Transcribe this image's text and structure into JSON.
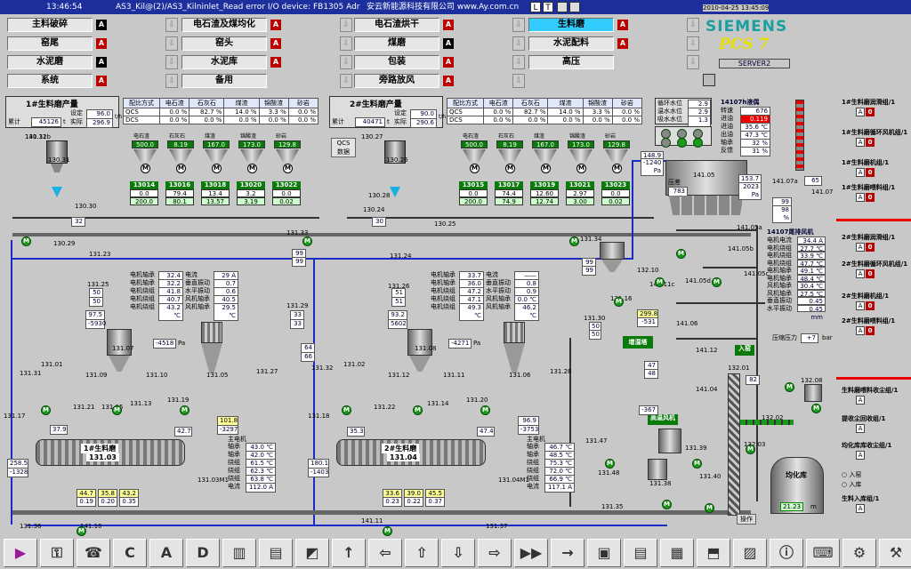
{
  "header": {
    "time": "13:46:54",
    "message": "AS3_Kil@(2)/AS3_Kilninlet_Read error I/O device: FB1305 Adr",
    "company": "安云新能源科技有限公司 www.Ay.com.cn",
    "datetime": "2010-04-25 13:45:09",
    "brand": "SIEMENS",
    "product": "PCS 7",
    "server": "SERVER2",
    "nav_icons": [
      "L",
      "T"
    ]
  },
  "nav": [
    {
      "label": "主料破碎",
      "alarm": "A",
      "black": true
    },
    {
      "label": "电石渣及煤均化",
      "alarm": "A",
      "black": false
    },
    {
      "label": "电石渣烘干",
      "alarm": "A",
      "black": false
    },
    {
      "label": "生料磨",
      "alarm": "A",
      "black": false,
      "active": true
    },
    {
      "label": "窑尾",
      "alarm": "A",
      "black": false
    },
    {
      "label": "窑头",
      "alarm": "A",
      "black": false
    },
    {
      "label": "煤磨",
      "alarm": "A",
      "black": true
    },
    {
      "label": "水泥配料",
      "alarm": "A",
      "black": false
    },
    {
      "label": "水泥磨",
      "alarm": "A",
      "black": true
    },
    {
      "label": "水泥库",
      "alarm": "A",
      "black": false
    },
    {
      "label": "包装",
      "alarm": "A",
      "black": false
    },
    {
      "label": "高压",
      "alarm": "",
      "black": false
    },
    {
      "label": "系统",
      "alarm": "A",
      "black": false
    },
    {
      "label": "备用",
      "alarm": "",
      "black": false
    },
    {
      "label": "旁路放风",
      "alarm": "A",
      "black": false
    }
  ],
  "mill1": {
    "title": "1#生料磨产量",
    "set_label": "设定",
    "set_val": "96.0",
    "act_label": "实际",
    "act_val": "296.9",
    "unit": "t/h",
    "total_label": "累计",
    "total_val": "45126",
    "total_unit": "t",
    "table": {
      "headers": [
        "配比方式",
        "电石渣",
        "石灰石",
        "煤渣",
        "锦酸渣",
        "砂岩"
      ],
      "rows": [
        [
          "QCS",
          "0.0 %",
          "82.7 %",
          "14.0 %",
          "3.3 %",
          "0.0 %"
        ],
        [
          "DCS",
          "0.0 %",
          "0.0 %",
          "0.0 %",
          "0.0 %",
          "0.0 %"
        ]
      ]
    },
    "bins": [
      [
        "电石渣",
        "500.0"
      ],
      [
        "石灰石",
        "8.19"
      ],
      [
        "煤渣",
        "167.0"
      ],
      [
        "锦酸渣",
        "173.0"
      ],
      [
        "砂岩",
        "129.8"
      ]
    ],
    "feeders": [
      {
        "id": "13014",
        "a": "0.0",
        "b": "200.0"
      },
      {
        "id": "13016",
        "a": "79.4",
        "b": "80.1"
      },
      {
        "id": "13018",
        "a": "13.4",
        "b": "13.57"
      },
      {
        "id": "13020",
        "a": "3.2",
        "b": "3.19"
      },
      {
        "id": "13022",
        "a": "0.0",
        "b": "0.02"
      }
    ],
    "motor_temps": [
      [
        "电机轴承",
        "32.4 ℃"
      ],
      [
        "电机轴承",
        "32.2 ℃"
      ],
      [
        "电机绕组",
        "41.8 ℃"
      ],
      [
        "电机绕组",
        "40.7 ℃"
      ],
      [
        "电机绕组",
        "43.2 ℃"
      ]
    ],
    "motor_right": [
      [
        "电流",
        "29 A"
      ],
      [
        "垂直振动",
        "0.7 mm"
      ],
      [
        "水平振动",
        "0.6 mm"
      ],
      [
        "风机轴承",
        "40.5 ℃"
      ],
      [
        "风机轴承",
        "29.5 ℃"
      ]
    ],
    "pressure1": "97.5",
    "pressure2": "-5930",
    "pa": "Pa",
    "p_cyclone": "-4518",
    "p_cyclone_u": "Pa",
    "pct_a": "50",
    "pct_b": "50",
    "pct_c": "33",
    "pct_d": "33",
    "out_temp": "101.8",
    "out_press": "-3297",
    "in_temp": "37.9",
    "mid_temp": "42.7",
    "mill_name": "1#生料磨",
    "mill_id": "131.03",
    "motor_id": "131.03M1",
    "main_motor_title": "主电机",
    "main_motor": [
      [
        "轴承",
        "43.0 ℃"
      ],
      [
        "轴承",
        "42.0 ℃"
      ],
      [
        "绕组",
        "61.5 ℃"
      ],
      [
        "绕组",
        "62.3 ℃"
      ],
      [
        "绕组",
        "63.8 ℃"
      ],
      [
        "电流",
        "112.0 A"
      ]
    ],
    "yellow": [
      "44.7",
      "35.8",
      "43.2"
    ],
    "blue": [
      "0.19",
      "0.20",
      "0.35"
    ],
    "left_temp": "258.5",
    "left_press": "-1328",
    "pa2": "Pa"
  },
  "mill2": {
    "title": "2#生料磨产量",
    "set_label": "设定",
    "set_val": "90.0",
    "act_label": "实际",
    "act_val": "290.6",
    "unit": "t/h",
    "total_label": "累计",
    "total_val": "40471",
    "total_unit": "t",
    "table": {
      "headers": [
        "配比方式",
        "电石渣",
        "石灰石",
        "煤渣",
        "锦酸渣",
        "砂岩"
      ],
      "rows": [
        [
          "QCS",
          "0.0 %",
          "82.7 %",
          "14.0 %",
          "3.3 %",
          "0.0 %"
        ],
        [
          "DCS",
          "0.0 %",
          "0.0 %",
          "0.0 %",
          "0.0 %",
          "0.0 %"
        ]
      ]
    },
    "bins": [
      [
        "电石渣",
        "500.0"
      ],
      [
        "石灰石",
        "8.19"
      ],
      [
        "煤渣",
        "167.0"
      ],
      [
        "锦酸渣",
        "173.0"
      ],
      [
        "砂岩",
        "129.8"
      ]
    ],
    "feeders": [
      {
        "id": "13015",
        "a": "0.0",
        "b": "200.0"
      },
      {
        "id": "13017",
        "a": "74.4",
        "b": "74.9"
      },
      {
        "id": "13019",
        "a": "12.60",
        "b": "12.74"
      },
      {
        "id": "13021",
        "a": "2.97",
        "b": "3.00"
      },
      {
        "id": "13023",
        "a": "0.0",
        "b": "0.02"
      }
    ],
    "motor_temps": [
      [
        "电机轴承",
        "33.7 ℃"
      ],
      [
        "电机轴承",
        "36.0 ℃"
      ],
      [
        "电机绕组",
        "47.2 ℃"
      ],
      [
        "电机绕组",
        "47.1 ℃"
      ],
      [
        "电机绕组",
        "49.3 ℃"
      ]
    ],
    "motor_right": [
      [
        "电流",
        "——"
      ],
      [
        "垂直振动",
        "0.8 mm"
      ],
      [
        "水平振动",
        "0.9 mm"
      ],
      [
        "风机轴承",
        "0.0 ℃"
      ],
      [
        "风机轴承",
        "46.2 ℃"
      ]
    ],
    "pressure1": "93.2",
    "pressure2": "5602",
    "pa": "Pa",
    "p_cyclone": "-4271",
    "p_cyclone_u": "Pa",
    "pct_a": "64",
    "pct_b": "66",
    "pct_c": "51",
    "pct_d": "51",
    "out_temp": "96.9",
    "out_press": "-3753",
    "in_temp": "35.3",
    "mid_temp": "47.4",
    "mill_name": "2#生料磨",
    "mill_id": "131.04",
    "motor_id": "131.04M1",
    "main_motor_title": "主电机",
    "main_motor": [
      [
        "轴承",
        "46.7 ℃"
      ],
      [
        "轴承",
        "48.5 ℃"
      ],
      [
        "绕组",
        "75.3 ℃"
      ],
      [
        "绕组",
        "72.0 ℃"
      ],
      [
        "绕组",
        "66.9 ℃"
      ],
      [
        "电流",
        "117.1 A"
      ]
    ],
    "yellow": [
      "33.6",
      "39.0",
      "45.5"
    ],
    "blue": [
      "0.23",
      "0.22",
      "0.37"
    ],
    "left_temp": "180.1",
    "left_press": "-1403",
    "pa2": "Pa"
  },
  "qcs": {
    "line1": "QCS",
    "line2": "数据"
  },
  "cooling": {
    "rows": [
      [
        "循环水位",
        "2.9 m"
      ],
      [
        "温水水位",
        "2.9 m"
      ],
      [
        "吸水水位",
        "1.3 m"
      ]
    ]
  },
  "fan14107": {
    "title": "14107h液偶",
    "rows": [
      [
        "转速",
        "676 rpm"
      ],
      [
        "进油",
        "0.119 MPa"
      ],
      [
        "进油",
        "35.6 ℃"
      ],
      [
        "出油",
        "47.3 ℃"
      ],
      [
        "轴承",
        "32 %"
      ],
      [
        "反馈",
        "31 %"
      ]
    ]
  },
  "fan_right_val": "65",
  "fan_right_id": "141.07",
  "tank": {
    "t1": "148.9 ℃",
    "t2": "-1240 Pa",
    "id": "141.05",
    "label": "压差",
    "val": "783",
    "t3": "153.7 ℃",
    "t4": "2023 Pa",
    "id2": "141.07a",
    "p1": "99 %",
    "p2": "98 %"
  },
  "fan_table": {
    "title": "14107尾排风机",
    "rows": [
      [
        "电机电流",
        "34.4 A"
      ],
      [
        "电机绕组",
        "27.7 ℃"
      ],
      [
        "电机绕组",
        "33.9 ℃"
      ],
      [
        "电机绕组",
        "47.7 ℃"
      ],
      [
        "电机轴承",
        "49.1 ℃"
      ],
      [
        "电机轴承",
        "48.4 ℃"
      ],
      [
        "风机轴承",
        "30.4 ℃"
      ],
      [
        "风机轴承",
        "27.5 ℃"
      ],
      [
        "垂直振动",
        "0.45 mm"
      ],
      [
        "水平振动",
        "0.45 mm"
      ]
    ]
  },
  "right_panel": [
    {
      "t": "1#生料磨润滑组/1",
      "a": "A",
      "b": "0"
    },
    {
      "t": "1#生料磨循环风机组/1",
      "a": "A",
      "b": "0"
    },
    {
      "t": "1#生料磨机组/1",
      "a": "A",
      "b": "0"
    },
    {
      "t": "1#生料磨喂料组/1",
      "a": "A",
      "b": "0"
    },
    {
      "t": "2#生料磨润滑组/1",
      "a": "A",
      "b": "0"
    },
    {
      "t": "2#生料磨循环风机组/1",
      "a": "A",
      "b": "0"
    },
    {
      "t": "2#生料磨机组/1",
      "a": "A",
      "b": "0"
    },
    {
      "t": "2#生料磨喂料组/1",
      "a": "A",
      "b": "0"
    },
    {
      "t": "生料磨喂料收尘组/1",
      "a": "A",
      "b": ""
    },
    {
      "t": "提收尘回收组/1",
      "a": "A",
      "b": ""
    },
    {
      "t": "均化库库收尘组/1",
      "a": "A",
      "b": ""
    },
    {
      "t": "生料入库组/1",
      "a": "A",
      "b": ""
    }
  ],
  "homog": {
    "title": "均化库",
    "val": "21.23",
    "unit": "m",
    "op": "操作",
    "in1": "入窑",
    "in2": "入库"
  },
  "misc": {
    "tank_press_label": "压缩压力",
    "tank_press": "+7",
    "tank_press_u": "bar",
    "zengshi": "增湿塔",
    "gaowen": "高温风机",
    "ruyao": "入窑",
    "p131_30a": "50",
    "p131_30b": "50",
    "t131_16": "299.8",
    "p131_16": "-531",
    "p131_16u": "Pa",
    "t_fan47": "47",
    "t_fan48": "48",
    "p_h1": "-367",
    "p_h1u": "Pa",
    "v82": "82",
    "p16": "99",
    "p17": "99",
    "p_b1": "99",
    "p_b2": "99",
    "p_c1": "32",
    "v_c30": "30",
    "v_131": "131.34"
  },
  "labels": [
    "130.32",
    "130.31",
    "130.30",
    "130.29",
    "130.27",
    "130.26",
    "130.25",
    "130.24",
    "130.28",
    "131.33",
    "131.31",
    "131.30",
    "131.29",
    "131.23",
    "131.24",
    "131.25",
    "131.26",
    "131.07",
    "131.08",
    "131.09",
    "131.10",
    "131.11",
    "131.12",
    "131.13",
    "131.14",
    "131.15",
    "131.16",
    "131.17",
    "131.18",
    "131.19",
    "131.20",
    "131.21",
    "131.22",
    "131.27",
    "131.28",
    "131.32",
    "131.01",
    "131.02",
    "131.05",
    "131.06",
    "131.35",
    "131.36",
    "131.37",
    "131.38",
    "131.39",
    "131.40",
    "131.47",
    "131.48",
    "141.11",
    "141.10",
    "141.12",
    "141.04",
    "141.06",
    "141.05a",
    "141.05b",
    "141.05c",
    "141.05d",
    "132.01",
    "132.02",
    "132.03",
    "132.08",
    "132.10",
    "141.11c",
    "141.11b"
  ],
  "toolbar": [
    "▶",
    "⚿",
    "☎",
    "C",
    "A",
    "D",
    "▥",
    "▤",
    "◩",
    "↑",
    "⇦",
    "⇧",
    "⇩",
    "⇨",
    "▶▶",
    "→",
    "▣",
    "▤",
    "▦",
    "⬒",
    "▨",
    "ⓘ",
    "⌨",
    "⚙",
    "⚒"
  ]
}
